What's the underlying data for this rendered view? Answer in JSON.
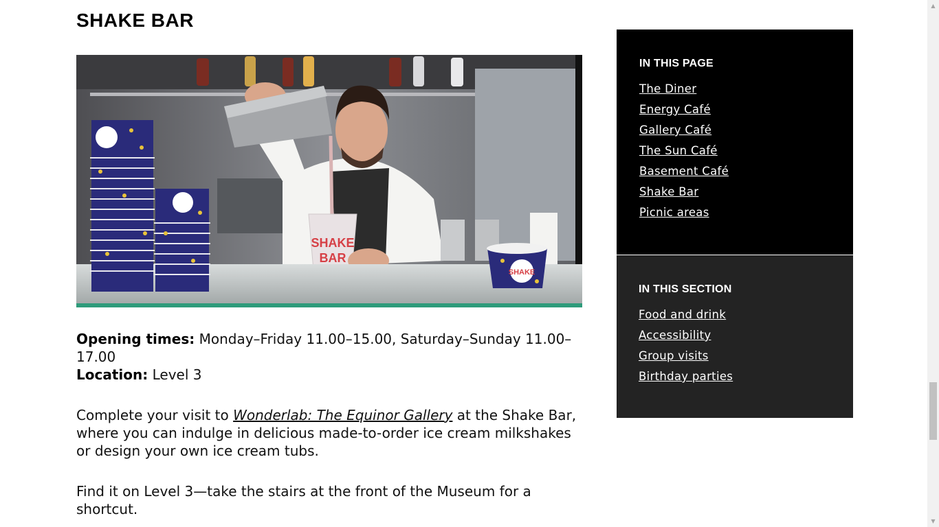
{
  "main": {
    "heading": "SHAKE BAR",
    "photo": {
      "cup_text_top": "SHAKE",
      "cup_text_bottom": "BAR",
      "stack_text": "SHAKE BAR"
    },
    "opening_label": "Opening times:",
    "opening_value": " Monday–Friday 11.00–15.00, Saturday–Sunday 11.00–17.00",
    "location_label": "Location:",
    "location_value": " Level 3",
    "para1_before": "Complete your visit to ",
    "para1_link": "Wonderlab: The Equinor Gallery",
    "para1_after": " at the Shake Bar, where you can indulge in delicious made-to-order ice cream milkshakes or design your own ice cream tubs.",
    "para2": "Find it on Level 3—take the stairs at the front of the Museum for a shortcut."
  },
  "sidebar": {
    "in_this_page": {
      "title": "IN THIS PAGE",
      "links": [
        "The Diner",
        "Energy Café",
        "Gallery Café",
        "The Sun Café",
        "Basement Café",
        "Shake Bar",
        "Picnic areas"
      ]
    },
    "in_this_section": {
      "title": "IN THIS SECTION",
      "links": [
        "Food and drink",
        "Accessibility",
        "Group visits",
        "Birthday parties"
      ]
    }
  },
  "icons": {
    "scroll_up": "scroll-up-arrow-icon",
    "scroll_down": "scroll-down-arrow-icon"
  },
  "colors": {
    "sidebar_page_bg": "#000000",
    "sidebar_section_bg": "#232323",
    "link_color": "#ffffff"
  }
}
